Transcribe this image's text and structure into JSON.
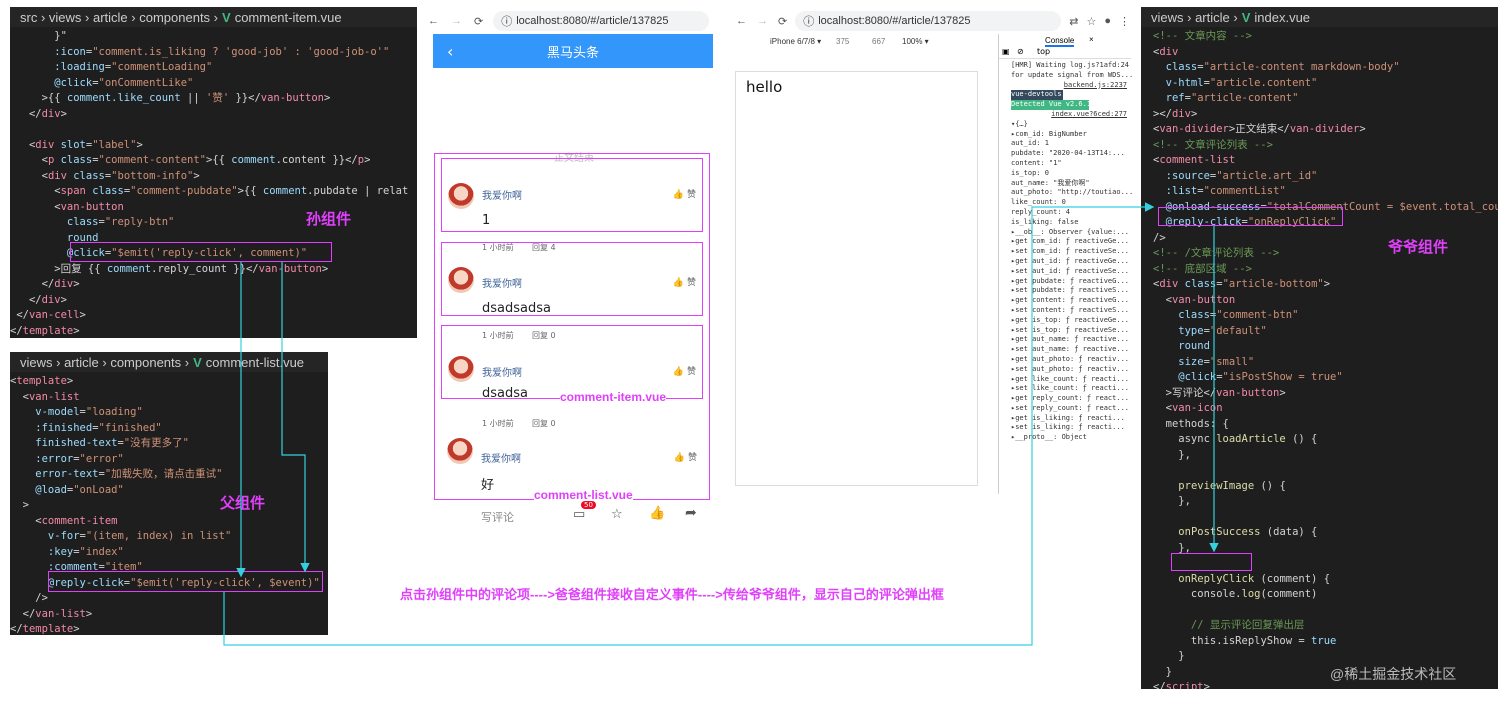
{
  "item_panel": {
    "breadcrumb": [
      "src",
      "views",
      "article",
      "components"
    ],
    "filename": "comment-item.vue",
    "lines": [
      [
        [
          "t-txt",
          "       }\""
        ]
      ],
      [
        [
          "t-attr",
          "       :icon"
        ],
        [
          "t-txt",
          "="
        ],
        [
          "t-str",
          "\"comment.is_liking ? 'good-job' : 'good-job-o'\""
        ]
      ],
      [
        [
          "t-attr",
          "       :loading"
        ],
        [
          "t-txt",
          "="
        ],
        [
          "t-str",
          "\"commentLoading\""
        ]
      ],
      [
        [
          "t-attr",
          "       @click"
        ],
        [
          "t-txt",
          "="
        ],
        [
          "t-str",
          "\"onCommentLike\""
        ]
      ],
      [
        [
          "t-txt",
          "     >{{ "
        ],
        [
          "t-attr",
          "comment.like_count"
        ],
        [
          "t-txt",
          " || "
        ],
        [
          "t-str",
          "'赞'"
        ],
        [
          "t-txt",
          " }}</"
        ],
        [
          "t-tag",
          "van-button"
        ],
        [
          "t-txt",
          ">"
        ]
      ],
      [
        [
          "t-txt",
          "   </"
        ],
        [
          "t-tag",
          "div"
        ],
        [
          "t-txt",
          ">"
        ]
      ],
      [
        [
          "t-txt",
          ""
        ]
      ],
      [
        [
          "t-txt",
          "   <"
        ],
        [
          "t-tag",
          "div"
        ],
        [
          "t-attr",
          " slot"
        ],
        [
          "t-txt",
          "="
        ],
        [
          "t-str",
          "\"label\""
        ],
        [
          "t-txt",
          ">"
        ]
      ],
      [
        [
          "t-txt",
          "     <"
        ],
        [
          "t-tag",
          "p"
        ],
        [
          "t-attr",
          " class"
        ],
        [
          "t-txt",
          "="
        ],
        [
          "t-str",
          "\"comment-content\""
        ],
        [
          "t-txt",
          ">{{ "
        ],
        [
          "t-attr",
          "comment"
        ],
        [
          "t-txt",
          ".content }}</"
        ],
        [
          "t-tag",
          "p"
        ],
        [
          "t-txt",
          ">"
        ]
      ],
      [
        [
          "t-txt",
          "     <"
        ],
        [
          "t-tag",
          "div"
        ],
        [
          "t-attr",
          " class"
        ],
        [
          "t-txt",
          "="
        ],
        [
          "t-str",
          "\"bottom-info\""
        ],
        [
          "t-txt",
          ">"
        ]
      ],
      [
        [
          "t-txt",
          "       <"
        ],
        [
          "t-tag",
          "span"
        ],
        [
          "t-attr",
          " class"
        ],
        [
          "t-txt",
          "="
        ],
        [
          "t-str",
          "\"comment-pubdate\""
        ],
        [
          "t-txt",
          ">{{ "
        ],
        [
          "t-attr",
          "comment"
        ],
        [
          "t-txt",
          ".pubdate | relat"
        ]
      ],
      [
        [
          "t-txt",
          "       <"
        ],
        [
          "t-tag",
          "van-button"
        ]
      ],
      [
        [
          "t-attr",
          "         class"
        ],
        [
          "t-txt",
          "="
        ],
        [
          "t-str",
          "\"reply-btn\""
        ]
      ],
      [
        [
          "t-attr",
          "         round"
        ]
      ],
      [
        [
          "t-attr",
          "         @click"
        ],
        [
          "t-txt",
          "="
        ],
        [
          "t-str",
          "\"$emit('reply-click', comment)\""
        ]
      ],
      [
        [
          "t-txt",
          "       >回复 {{ "
        ],
        [
          "t-attr",
          "comment"
        ],
        [
          "t-txt",
          ".reply_count }}</"
        ],
        [
          "t-tag",
          "van-button"
        ],
        [
          "t-txt",
          ">"
        ]
      ],
      [
        [
          "t-txt",
          "     </"
        ],
        [
          "t-tag",
          "div"
        ],
        [
          "t-txt",
          ">"
        ]
      ],
      [
        [
          "t-txt",
          "   </"
        ],
        [
          "t-tag",
          "div"
        ],
        [
          "t-txt",
          ">"
        ]
      ],
      [
        [
          "t-txt",
          " </"
        ],
        [
          "t-tag",
          "van-cell"
        ],
        [
          "t-txt",
          ">"
        ]
      ],
      [
        [
          "t-txt",
          "</"
        ],
        [
          "t-tag",
          "template"
        ],
        [
          "t-txt",
          ">"
        ]
      ]
    ],
    "label": "孙组件"
  },
  "list_panel": {
    "breadcrumb": [
      "views",
      "article",
      "components"
    ],
    "filename": "comment-list.vue",
    "lines": [
      [
        [
          "t-txt",
          "<"
        ],
        [
          "t-tag",
          "template"
        ],
        [
          "t-txt",
          ">"
        ]
      ],
      [
        [
          "t-txt",
          "  <"
        ],
        [
          "t-tag",
          "van-list"
        ]
      ],
      [
        [
          "t-attr",
          "    v-model"
        ],
        [
          "t-txt",
          "="
        ],
        [
          "t-str",
          "\"loading\""
        ]
      ],
      [
        [
          "t-attr",
          "    :finished"
        ],
        [
          "t-txt",
          "="
        ],
        [
          "t-str",
          "\"finished\""
        ]
      ],
      [
        [
          "t-attr",
          "    finished-text"
        ],
        [
          "t-txt",
          "="
        ],
        [
          "t-str",
          "\"没有更多了\""
        ]
      ],
      [
        [
          "t-attr",
          "    :error"
        ],
        [
          "t-txt",
          "="
        ],
        [
          "t-str",
          "\"error\""
        ]
      ],
      [
        [
          "t-attr",
          "    error-text"
        ],
        [
          "t-txt",
          "="
        ],
        [
          "t-str",
          "\"加载失败，请点击重试\""
        ]
      ],
      [
        [
          "t-attr",
          "    @load"
        ],
        [
          "t-txt",
          "="
        ],
        [
          "t-str",
          "\"onLoad\""
        ]
      ],
      [
        [
          "t-txt",
          "  >"
        ]
      ],
      [
        [
          "t-txt",
          "    <"
        ],
        [
          "t-tag",
          "comment-item"
        ]
      ],
      [
        [
          "t-attr",
          "      v-for"
        ],
        [
          "t-txt",
          "="
        ],
        [
          "t-str",
          "\"(item, index) in list\""
        ]
      ],
      [
        [
          "t-attr",
          "      :key"
        ],
        [
          "t-txt",
          "="
        ],
        [
          "t-str",
          "\"index\""
        ]
      ],
      [
        [
          "t-attr",
          "      :comment"
        ],
        [
          "t-txt",
          "="
        ],
        [
          "t-str",
          "\"item\""
        ]
      ],
      [
        [
          "t-attr",
          "      @reply-click"
        ],
        [
          "t-txt",
          "="
        ],
        [
          "t-str",
          "\"$emit('reply-click', $event)\""
        ]
      ],
      [
        [
          "t-txt",
          "    />"
        ]
      ],
      [
        [
          "t-txt",
          "  </"
        ],
        [
          "t-tag",
          "van-list"
        ],
        [
          "t-txt",
          ">"
        ]
      ],
      [
        [
          "t-txt",
          "</"
        ],
        [
          "t-tag",
          "template"
        ],
        [
          "t-txt",
          ">"
        ]
      ]
    ],
    "label": "父组件"
  },
  "index_panel": {
    "breadcrumb": [
      "views",
      "article"
    ],
    "filename": "index.vue",
    "lines": [
      [
        [
          "t-com",
          "<!-- 文章内容 -->"
        ]
      ],
      [
        [
          "t-txt",
          "<"
        ],
        [
          "t-tag",
          "div"
        ]
      ],
      [
        [
          "t-attr",
          "  class"
        ],
        [
          "t-txt",
          "="
        ],
        [
          "t-str",
          "\"article-content markdown-body\""
        ]
      ],
      [
        [
          "t-attr",
          "  v-html"
        ],
        [
          "t-txt",
          "="
        ],
        [
          "t-str",
          "\"article.content\""
        ]
      ],
      [
        [
          "t-attr",
          "  ref"
        ],
        [
          "t-txt",
          "="
        ],
        [
          "t-str",
          "\"article-content\""
        ]
      ],
      [
        [
          "t-txt",
          "></"
        ],
        [
          "t-tag",
          "div"
        ],
        [
          "t-txt",
          ">"
        ]
      ],
      [
        [
          "t-txt",
          "<"
        ],
        [
          "t-tag",
          "van-divider"
        ],
        [
          "t-txt",
          ">正文结束</"
        ],
        [
          "t-tag",
          "van-divider"
        ],
        [
          "t-txt",
          ">"
        ]
      ],
      [
        [
          "t-com",
          "<!-- 文章评论列表 -->"
        ]
      ],
      [
        [
          "t-txt",
          "<"
        ],
        [
          "t-tag",
          "comment-list"
        ]
      ],
      [
        [
          "t-attr",
          "  :source"
        ],
        [
          "t-txt",
          "="
        ],
        [
          "t-str",
          "\"article.art_id\""
        ]
      ],
      [
        [
          "t-attr",
          "  :list"
        ],
        [
          "t-txt",
          "="
        ],
        [
          "t-str",
          "\"commentList\""
        ]
      ],
      [
        [
          "t-attr",
          "  @onload-success"
        ],
        [
          "t-txt",
          "="
        ],
        [
          "t-str",
          "\"totalCommentCount = $event.total_count"
        ]
      ],
      [
        [
          "t-attr",
          "  @reply-click"
        ],
        [
          "t-txt",
          "="
        ],
        [
          "t-str",
          "\"onReplyClick\""
        ]
      ],
      [
        [
          "t-txt",
          "/>"
        ]
      ],
      [
        [
          "t-com",
          "<!-- /文章评论列表 -->"
        ]
      ],
      [
        [
          "t-com",
          "<!-- 底部区域 -->"
        ]
      ],
      [
        [
          "t-txt",
          "<"
        ],
        [
          "t-tag",
          "div"
        ],
        [
          "t-attr",
          " class"
        ],
        [
          "t-txt",
          "="
        ],
        [
          "t-str",
          "\"article-bottom\""
        ],
        [
          "t-txt",
          ">"
        ]
      ],
      [
        [
          "t-txt",
          "  <"
        ],
        [
          "t-tag",
          "van-button"
        ]
      ],
      [
        [
          "t-attr",
          "    class"
        ],
        [
          "t-txt",
          "="
        ],
        [
          "t-str",
          "\"comment-btn\""
        ]
      ],
      [
        [
          "t-attr",
          "    type"
        ],
        [
          "t-txt",
          "="
        ],
        [
          "t-str",
          "\"default\""
        ]
      ],
      [
        [
          "t-attr",
          "    round"
        ]
      ],
      [
        [
          "t-attr",
          "    size"
        ],
        [
          "t-txt",
          "="
        ],
        [
          "t-str",
          "\"small\""
        ]
      ],
      [
        [
          "t-attr",
          "    @click"
        ],
        [
          "t-txt",
          "="
        ],
        [
          "t-str",
          "\"isPostShow = true\""
        ]
      ],
      [
        [
          "t-txt",
          "  >写评论</"
        ],
        [
          "t-tag",
          "van-button"
        ],
        [
          "t-txt",
          ">"
        ]
      ],
      [
        [
          "t-txt",
          "  <"
        ],
        [
          "t-tag",
          "van-icon"
        ]
      ],
      [
        [
          "t-txt",
          "  methods: {"
        ]
      ],
      [
        [
          "t-txt",
          "    async "
        ],
        [
          "t-fn",
          "loadArticle"
        ],
        [
          "t-txt",
          " () {"
        ]
      ],
      [
        [
          "t-txt",
          "    },"
        ]
      ],
      [
        [
          "t-txt",
          ""
        ]
      ],
      [
        [
          "t-txt",
          "    "
        ],
        [
          "t-fn",
          "previewImage"
        ],
        [
          "t-txt",
          " () {"
        ]
      ],
      [
        [
          "t-txt",
          "    },"
        ]
      ],
      [
        [
          "t-txt",
          ""
        ]
      ],
      [
        [
          "t-txt",
          "    "
        ],
        [
          "t-fn",
          "onPostSuccess"
        ],
        [
          "t-txt",
          " (data) {"
        ]
      ],
      [
        [
          "t-txt",
          "    },"
        ]
      ],
      [
        [
          "t-txt",
          ""
        ]
      ],
      [
        [
          "t-txt",
          "    "
        ],
        [
          "t-fn",
          "onReplyClick"
        ],
        [
          "t-txt",
          " (comment) {"
        ]
      ],
      [
        [
          "t-txt",
          "      console."
        ],
        [
          "t-fn",
          "log"
        ],
        [
          "t-txt",
          "(comment)"
        ]
      ],
      [
        [
          "t-txt",
          ""
        ]
      ],
      [
        [
          "t-com",
          "      // 显示评论回复弹出层"
        ]
      ],
      [
        [
          "t-txt",
          "      this.isReplyShow = "
        ],
        [
          "t-attr",
          "true"
        ]
      ],
      [
        [
          "t-txt",
          "    }"
        ]
      ],
      [
        [
          "t-txt",
          "  }"
        ]
      ],
      [
        [
          "t-txt",
          "</"
        ],
        [
          "t-tag",
          "script"
        ],
        [
          "t-txt",
          ">"
        ]
      ]
    ],
    "label": "爷爷组件"
  },
  "browser1": {
    "url": "localhost:8080/#/article/137825",
    "nav_title": "黑马头条",
    "divider_text": "正文结束",
    "comments": [
      {
        "name": "我爱你啊",
        "content": "1",
        "likes": "赞",
        "time": "1 小时前",
        "reply": "回复 4"
      },
      {
        "name": "我爱你啊",
        "content": "dsadsadsa",
        "likes": "赞",
        "time": "1 小时前",
        "reply": "回复 0"
      },
      {
        "name": "我爱你啊",
        "content": "dsadsa",
        "likes": "赞",
        "time": "1 小时前",
        "reply": "回复 0"
      },
      {
        "name": "我爱你啊",
        "content": "好",
        "likes": "赞"
      }
    ],
    "item_label": "comment-item.vue",
    "list_label": "comment-list.vue",
    "write_comment": "写评论",
    "badge": "50"
  },
  "browser2": {
    "url": "localhost:8080/#/article/137825",
    "device": "iPhone 6/7/8 ▾",
    "width": "375",
    "height": "667",
    "zoom": "100% ▾",
    "console_tab": "Console",
    "context": "top",
    "page_text": "hello",
    "console_lines": [
      "[HMR] Waiting log.js?1afd:24",
      "for update signal from WDS...",
      "backend.js:2237",
      "vue-devtools",
      "Detected Vue v2.6.11",
      "index.vue?6ced:277",
      "▾{…}",
      "  ▸com_id: BigNumber",
      "   aut_id: 1",
      "   pubdate: \"2020-04-13T14:...",
      "   content: \"1\"",
      "   is_top: 0",
      "   aut_name: \"我爱你啊\"",
      "   aut_photo: \"http://toutiao...",
      "   like_count: 0",
      "   reply_count: 4",
      "   is_liking: false",
      "  ▸__ob__: Observer {value:...",
      "  ▸get com_id: ƒ reactiveGe...",
      "  ▸set com_id: ƒ reactiveSe...",
      "  ▸get aut_id: ƒ reactiveGe...",
      "  ▸set aut_id: ƒ reactiveSe...",
      "  ▸get pubdate: ƒ reactiveG...",
      "  ▸set pubdate: ƒ reactiveS...",
      "  ▸get content: ƒ reactiveG...",
      "  ▸set content: ƒ reactiveS...",
      "  ▸get is_top: ƒ reactiveGe...",
      "  ▸set is_top: ƒ reactiveSe...",
      "  ▸get aut_name: ƒ reactive...",
      "  ▸set aut_name: ƒ reactive...",
      "  ▸get aut_photo: ƒ reactiv...",
      "  ▸set aut_photo: ƒ reactiv...",
      "  ▸get like_count: ƒ reacti...",
      "  ▸set like_count: ƒ reacti...",
      "  ▸get reply_count: ƒ react...",
      "  ▸set reply_count: ƒ react...",
      "  ▸get is_liking: ƒ reacti...",
      "  ▸set is_liking: ƒ reacti...",
      "  ▸__proto__: Object"
    ]
  },
  "caption": "点击孙组件中的评论项---->爸爸组件接收自定义事件---->传给爷爷组件，显示自己的评论弹出框",
  "watermark": "@稀土掘金技术社区",
  "colors": {
    "arrow": "#35d0e0",
    "highlight": "#e040fb",
    "header": "#3296fa"
  }
}
